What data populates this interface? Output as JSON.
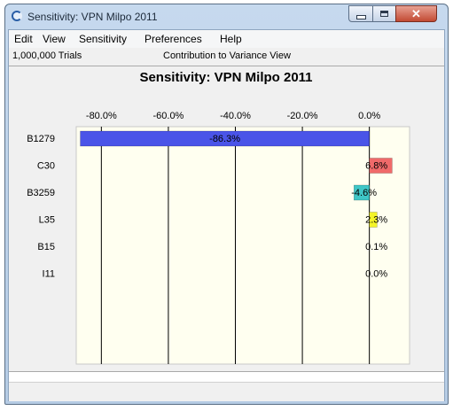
{
  "window": {
    "title": "Sensitivity: VPN Milpo 2011"
  },
  "menu": [
    "Edit",
    "View",
    "Sensitivity",
    "Preferences",
    "Help"
  ],
  "info": {
    "trials": "1,000,000 Trials",
    "view": "Contribution to Variance View"
  },
  "chart_data": {
    "type": "bar",
    "orientation": "horizontal",
    "title": "Sensitivity: VPN Milpo 2011",
    "categories": [
      "B1279",
      "C30",
      "B3259",
      "L35",
      "B15",
      "I11"
    ],
    "values": [
      -86.3,
      6.8,
      -4.6,
      2.3,
      0.1,
      0.0
    ],
    "value_labels": [
      "-86.3%",
      "6.8%",
      "-4.6%",
      "2.3%",
      "0.1%",
      "0.0%"
    ],
    "bar_colors": [
      "#4a54e8",
      "#f06a6a",
      "#3fc6c6",
      "#f4f428",
      "#f0f0f0",
      "#f0f0f0"
    ],
    "xticks": [
      -80,
      -60,
      -40,
      -20,
      0
    ],
    "xtick_labels": [
      "-80.0%",
      "-60.0%",
      "-40.0%",
      "-20.0%",
      "0.0%"
    ],
    "xlim": [
      -87.5,
      12
    ],
    "grid": "vertical",
    "background": "#fffff0"
  }
}
